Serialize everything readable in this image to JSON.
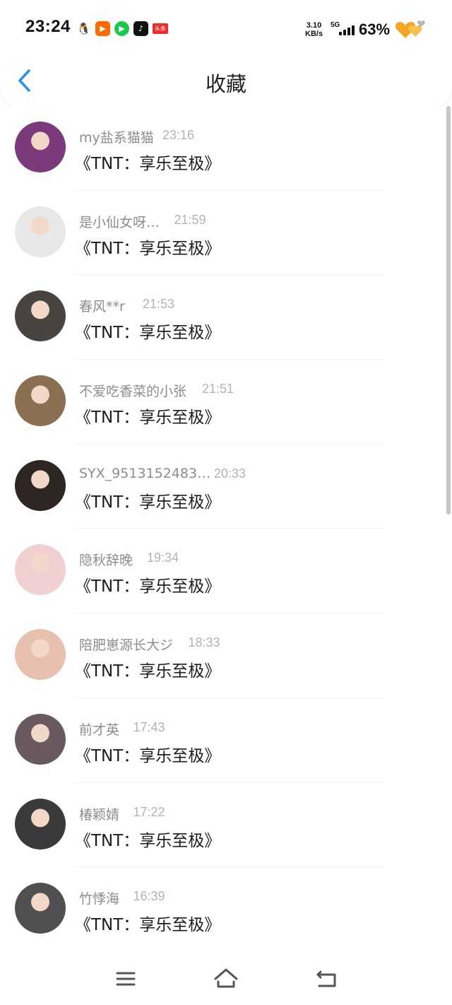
{
  "status_bar": {
    "time": "23:24",
    "notification_apps": [
      "qq-icon",
      "kuaishou-icon",
      "iqiyi-icon",
      "douyin-icon",
      "toutiao-icon"
    ],
    "toutiao_label": "头条",
    "net_speed_value": "3.10",
    "net_speed_unit": "KB/s",
    "net_type": "5G",
    "battery_percent": "63%",
    "battery_level": 0.63
  },
  "header": {
    "title": "收藏"
  },
  "list": {
    "items": [
      {
        "name": "my盐系猫猫",
        "time": "23:16",
        "content": "《TNT：享乐至极》",
        "avatar_color": "#7a3a7c"
      },
      {
        "name": "是小仙女呀…",
        "time": "21:59",
        "content": "《TNT：享乐至极》",
        "avatar_color": "#e8e8e8"
      },
      {
        "name": "春风**r",
        "time": "21:53",
        "content": "《TNT：享乐至极》",
        "avatar_color": "#4a4440"
      },
      {
        "name": "不爱吃香菜的小张",
        "time": "21:51",
        "content": "《TNT：享乐至极》",
        "avatar_color": "#8a7050"
      },
      {
        "name": "SYX_9513152483…",
        "time": "20:33",
        "content": "《TNT：享乐至极》",
        "avatar_color": "#2e2622"
      },
      {
        "name": "隐秋辞晚",
        "time": "19:34",
        "content": "《TNT：享乐至极》",
        "avatar_color": "#f0d0d0"
      },
      {
        "name": "陪肥崽源长大ジ",
        "time": "18:33",
        "content": "《TNT：享乐至极》",
        "avatar_color": "#e8c0b0"
      },
      {
        "name": "前才英",
        "time": "17:43",
        "content": "《TNT：享乐至极》",
        "avatar_color": "#6a5a60"
      },
      {
        "name": "椿颖婧",
        "time": "17:22",
        "content": "《TNT：享乐至极》",
        "avatar_color": "#3a3a3a"
      },
      {
        "name": "竹悸海",
        "time": "16:39",
        "content": "《TNT：享乐至极》",
        "avatar_color": "#505050"
      }
    ]
  },
  "bottom_nav": {
    "buttons": [
      "menu-icon",
      "home-icon",
      "back-icon"
    ]
  },
  "colors": {
    "accent": "#2b8cf5",
    "name_text": "#8d8d8d",
    "time_text": "#b3b3b3",
    "battery_heart": "#f5a623"
  }
}
